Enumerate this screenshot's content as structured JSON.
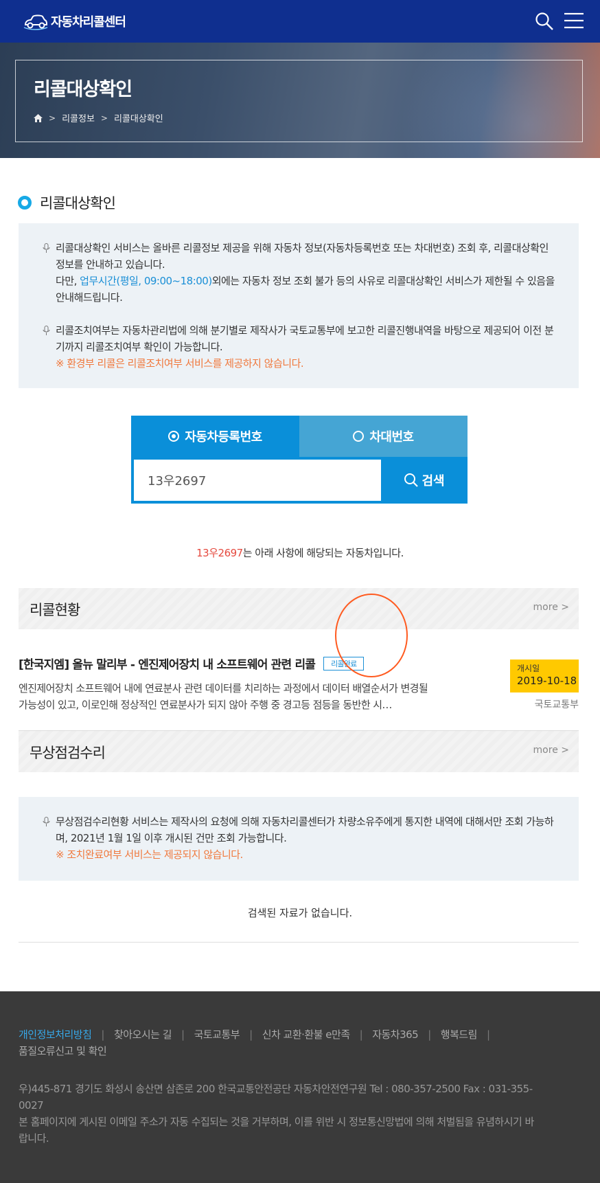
{
  "header": {
    "logo_text": "자동차리콜센터",
    "icons": {
      "search": "search-icon",
      "menu": "hamburger-menu-icon"
    }
  },
  "hero": {
    "title": "리콜대상확인",
    "breadcrumb": [
      "리콜정보",
      "리콜대상확인"
    ]
  },
  "section_title": "리콜대상확인",
  "info_notice": {
    "p1_line1": "리콜대상확인 서비스는 올바른 리콜정보 제공을 위해 자동차 정보(자동차등록번호 또는 차대번호) 조회 후, 리콜대상확인 정보를 안내하고 있습니다.",
    "p1_line2_prefix": "다만, ",
    "p1_line2_highlight": "업무시간(평일, 09:00~18:00)",
    "p1_line2_suffix": "외에는 자동차 정보 조회 불가 등의 사유로 리콜대상확인 서비스가 제한될 수 있음을 안내해드립니다.",
    "p2_text": "리콜조치여부는 자동차관리법에 의해 분기별로 제작사가 국토교통부에 보고한 리콜진행내역을 바탕으로 제공되어 이전 분기까지 리콜조치여부 확인이 가능합니다.",
    "p2_warning": "※ 환경부 리콜은 리콜조치여부 서비스를 제공하지 않습니다."
  },
  "search": {
    "tabs": [
      {
        "label": "자동차등록번호",
        "selected": true
      },
      {
        "label": "차대번호",
        "selected": false
      }
    ],
    "input_value": "13우2697",
    "button_label": "검색"
  },
  "result_msg": {
    "plate": "13우2697",
    "text": "는 아래 사항에 해당되는 자동차입니다."
  },
  "recall_status": {
    "title": "리콜현황",
    "more": "more",
    "items": [
      {
        "title": "[한국지엠] 올뉴 말리부 - 엔진제어장치 내 소프트웨어 관련 리콜",
        "badge": "리콜완료",
        "desc": "엔진제어장치 소프트웨어 내에 연료분사 관련 데이터를 치리하는 과정에서 데이터 배열순서가 변경될 가능성이 있고, 이로인해 정상적인 연료분사가 되지 않아 주행 중 경고등 점등을 동반한 시…",
        "date_label": "개시일",
        "date": "2019-10-18",
        "agency": "국토교통부"
      }
    ]
  },
  "free_inspection": {
    "title": "무상점검수리",
    "more": "more",
    "notice_text": "무상점검수리현황 서비스는 제작사의 요청에 의해 자동차리콜센터가 차량소유주에게 통지한 내역에 대해서만 조회 가능하며, 2021년 1월 1일 이후 개시된 건만 조회 가능합니다.",
    "notice_warning": "※ 조치완료여부 서비스는 제공되지 않습니다.",
    "empty": "검색된 자료가 없습니다."
  },
  "footer": {
    "links": [
      "개인정보처리방침",
      "찾아오시는 길",
      "국토교통부",
      "신차 교환·환불 e만족",
      "자동차365",
      "행복드림",
      "품질오류신고 및 확인"
    ],
    "address": "우)445-871 경기도 화성시 송산면 삼존로 200 한국교통안전공단 자동차안전연구원 Tel : 080-357-2500 Fax : 031-355-0027",
    "notice": "본 홈페이지에 게시된 이메일 주소가 자동 수집되는 것을 거부하며, 이를 위반 시 정보통신망법에 의해 처벌됨을 유념하시기 바랍니다."
  },
  "colors": {
    "header_bg": "#0f2f8f",
    "accent_blue": "#0a8fd9",
    "highlight_blue": "#1a8fd6",
    "warning_orange": "#f0783c",
    "plate_red": "#e5493e",
    "date_yellow": "#ffc900",
    "annotation_circle": "#ff5a1f"
  }
}
